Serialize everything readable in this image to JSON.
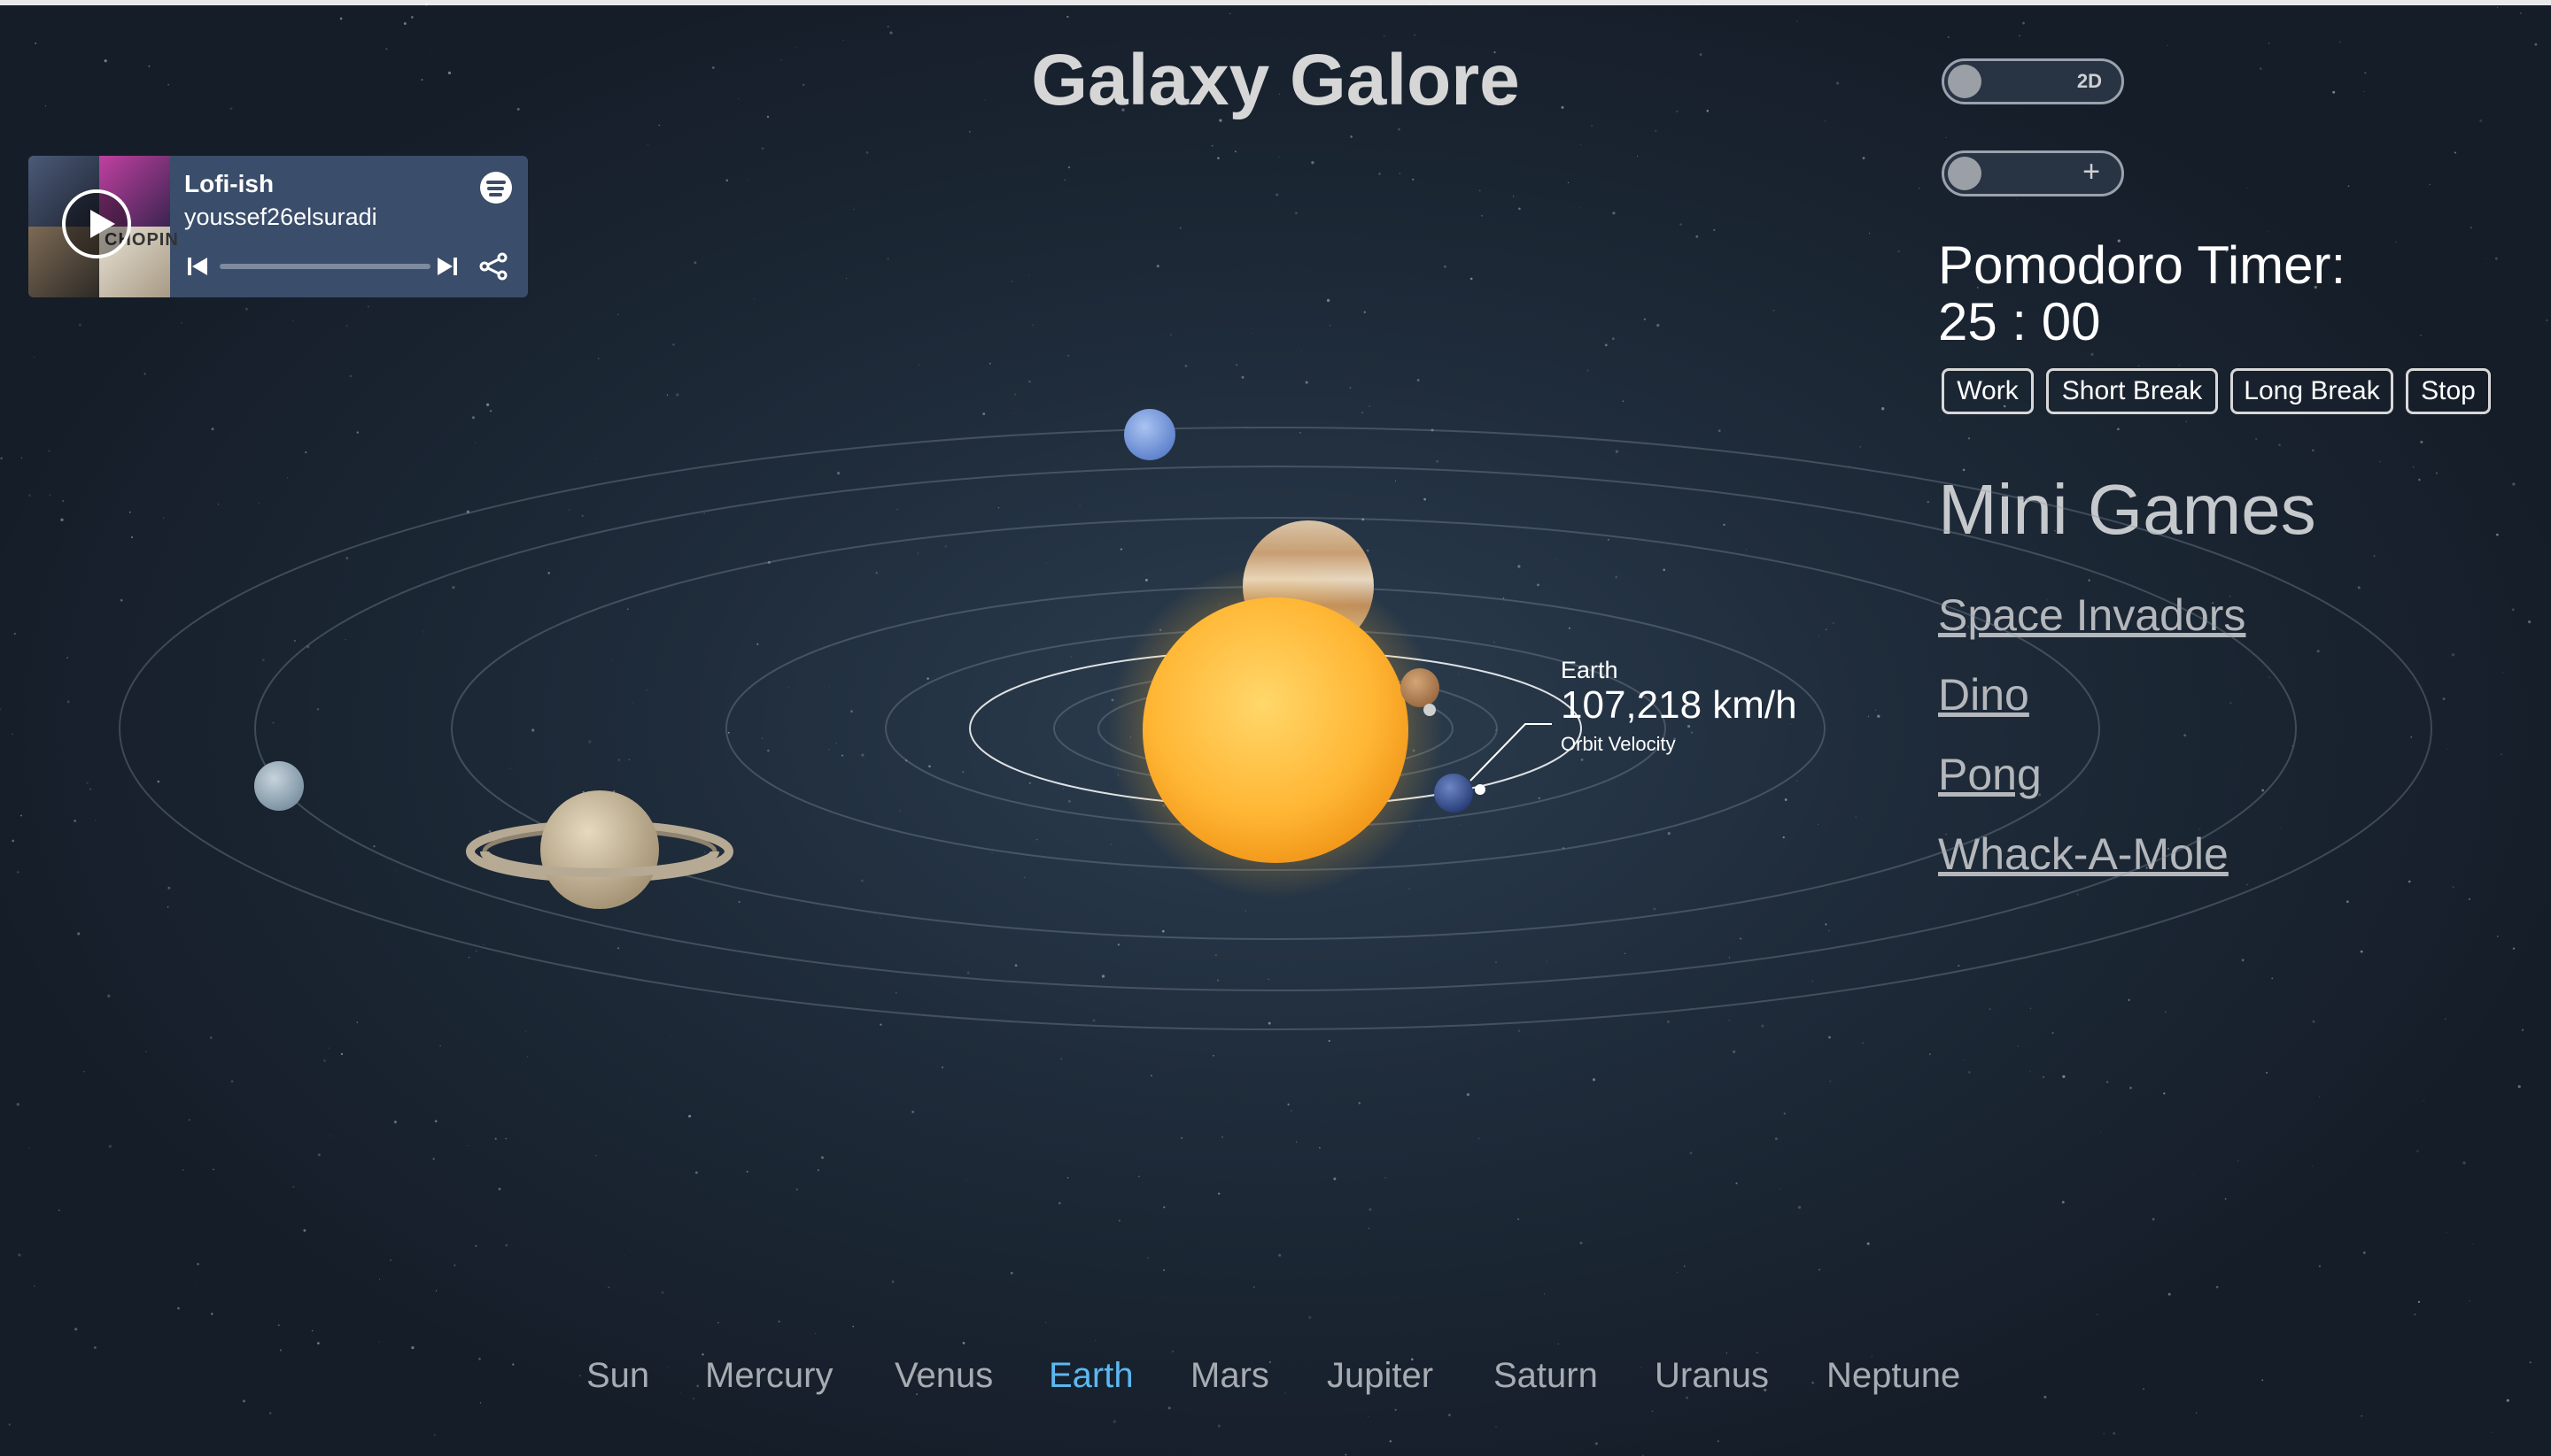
{
  "app": {
    "title": "Galaxy Galore"
  },
  "spotify": {
    "playlist": "Lofi-ish",
    "user": "youssef26elsuradi",
    "cover_text": "CHOPIN"
  },
  "toggles": [
    {
      "label": "2D"
    },
    {
      "label": "+"
    }
  ],
  "pomodoro": {
    "title": "Pomodoro Timer:",
    "time": "25 : 00",
    "buttons": [
      "Work",
      "Short Break",
      "Long Break",
      "Stop"
    ]
  },
  "mini_games": {
    "title": "Mini Games",
    "links": [
      "Space Invadors",
      "Dino",
      "Pong",
      "Whack-A-Mole"
    ]
  },
  "planet_info": {
    "name": "Earth",
    "value": "107,218 km/h",
    "caption": "Orbit Velocity"
  },
  "planets_nav": {
    "items": [
      "Sun",
      "Mercury",
      "Venus",
      "Earth",
      "Mars",
      "Jupiter",
      "Saturn",
      "Uranus",
      "Neptune"
    ],
    "active": "Earth"
  },
  "colors": {
    "active_nav": "#5cb8f0",
    "sun": "#ffb83a",
    "background": "#1f2c3b"
  }
}
